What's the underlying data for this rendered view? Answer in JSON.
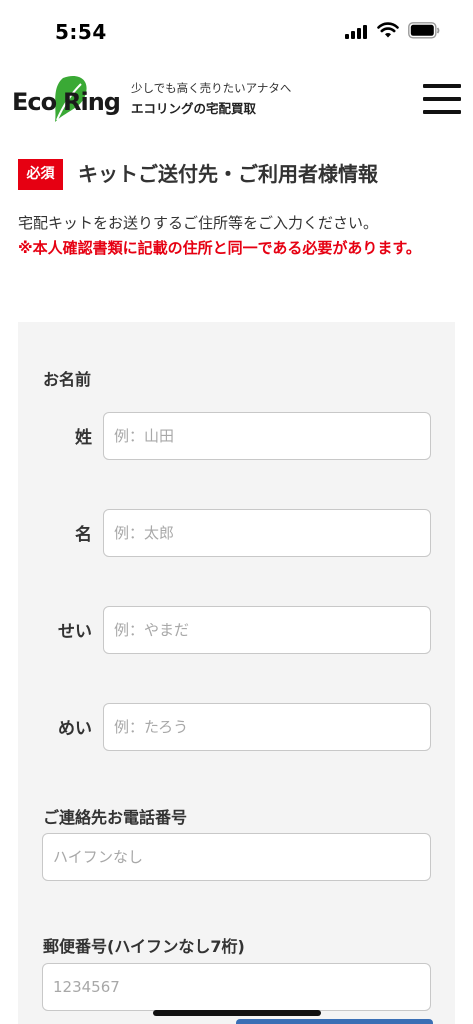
{
  "status": {
    "time": "5:54"
  },
  "header": {
    "logo_text": "EcoRing",
    "tagline": "少しでも高く売りたいアナタへ",
    "brand": "エコリングの宅配買取"
  },
  "section": {
    "badge": "必須",
    "title": "キットご送付先・ご利用者様情報",
    "intro": "宅配キットをお送りするご住所等をご入力ください。",
    "warning": "※本人確認書類に記載の住所と同一である必要があります。"
  },
  "form": {
    "name_title": "お名前",
    "last_name_label": "姓",
    "last_name_placeholder": "例：山田",
    "first_name_label": "名",
    "first_name_placeholder": "例：太郎",
    "last_kana_label": "せい",
    "last_kana_placeholder": "例：やまだ",
    "first_kana_label": "めい",
    "first_kana_placeholder": "例：たろう",
    "phone_title": "ご連絡先お電話番号",
    "phone_placeholder": "ハイフンなし",
    "zip_title": "郵便番号(ハイフンなし7桁)",
    "zip_placeholder": "1234567"
  },
  "colors": {
    "required_red": "#e60012",
    "logo_green": "#3aa935",
    "panel_bg": "#f4f4f4"
  }
}
